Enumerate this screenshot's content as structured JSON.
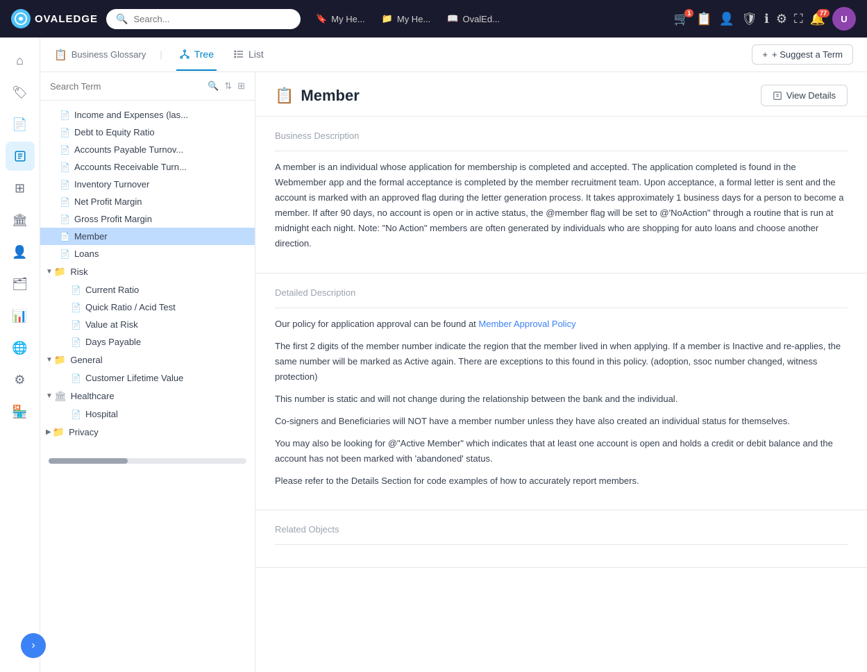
{
  "app": {
    "name": "OVALEDGE",
    "logo_char": "OE"
  },
  "topnav": {
    "search_placeholder": "Search...",
    "nav_items": [
      {
        "label": "My He...",
        "icon": "bookmark"
      },
      {
        "label": "My He...",
        "icon": "folder"
      },
      {
        "label": "OvalEd...",
        "icon": "book"
      }
    ],
    "icons": [
      {
        "name": "cart",
        "badge": "1"
      },
      {
        "name": "document"
      },
      {
        "name": "person-check"
      },
      {
        "name": "shield"
      },
      {
        "name": "info"
      },
      {
        "name": "settings"
      },
      {
        "name": "expand"
      },
      {
        "name": "bell",
        "badge": "77"
      }
    ]
  },
  "breadcrumb": {
    "label": "Business Glossary"
  },
  "tabs": [
    {
      "id": "tree",
      "label": "Tree",
      "active": true
    },
    {
      "id": "list",
      "label": "List",
      "active": false
    }
  ],
  "suggest_btn": "+ Suggest a Term",
  "search_placeholder": "Search Term",
  "tree_nodes": [
    {
      "id": "income",
      "label": "Income and Expenses (las...",
      "level": 1,
      "type": "doc",
      "expanded": false,
      "selected": false
    },
    {
      "id": "debt",
      "label": "Debt to Equity Ratio",
      "level": 1,
      "type": "doc",
      "expanded": false,
      "selected": false
    },
    {
      "id": "accounts_payable",
      "label": "Accounts Payable Turnov...",
      "level": 1,
      "type": "doc",
      "expanded": false,
      "selected": false
    },
    {
      "id": "accounts_receivable",
      "label": "Accounts Receivable Turn...",
      "level": 1,
      "type": "doc",
      "expanded": false,
      "selected": false
    },
    {
      "id": "inventory",
      "label": "Inventory Turnover",
      "level": 1,
      "type": "doc",
      "expanded": false,
      "selected": false
    },
    {
      "id": "net_profit",
      "label": "Net Profit Margin",
      "level": 1,
      "type": "doc",
      "expanded": false,
      "selected": false
    },
    {
      "id": "gross_profit",
      "label": "Gross Profit Margin",
      "level": 1,
      "type": "doc",
      "expanded": false,
      "selected": false
    },
    {
      "id": "member",
      "label": "Member",
      "level": 1,
      "type": "doc",
      "expanded": false,
      "selected": true
    },
    {
      "id": "loans",
      "label": "Loans",
      "level": 1,
      "type": "doc",
      "expanded": false,
      "selected": false
    },
    {
      "id": "risk",
      "label": "Risk",
      "level": 0,
      "type": "folder",
      "expanded": true,
      "selected": false
    },
    {
      "id": "current_ratio",
      "label": "Current Ratio",
      "level": 2,
      "type": "doc",
      "expanded": false,
      "selected": false
    },
    {
      "id": "quick_ratio",
      "label": "Quick Ratio / Acid Test",
      "level": 2,
      "type": "doc",
      "expanded": false,
      "selected": false
    },
    {
      "id": "value_at_risk",
      "label": "Value at Risk",
      "level": 2,
      "type": "doc",
      "expanded": false,
      "selected": false
    },
    {
      "id": "days_payable",
      "label": "Days Payable",
      "level": 2,
      "type": "doc",
      "expanded": false,
      "selected": false
    },
    {
      "id": "general",
      "label": "General",
      "level": 0,
      "type": "folder",
      "expanded": true,
      "selected": false
    },
    {
      "id": "customer_lifetime",
      "label": "Customer Lifetime Value",
      "level": 2,
      "type": "doc",
      "expanded": false,
      "selected": false
    },
    {
      "id": "healthcare",
      "label": "Healthcare",
      "level": 0,
      "type": "building",
      "expanded": true,
      "selected": false
    },
    {
      "id": "hospital",
      "label": "Hospital",
      "level": 2,
      "type": "doc",
      "expanded": false,
      "selected": false
    },
    {
      "id": "privacy",
      "label": "Privacy",
      "level": 0,
      "type": "folder",
      "expanded": false,
      "selected": false
    }
  ],
  "detail": {
    "title": "Member",
    "title_icon": "📋",
    "view_details_label": "View Details",
    "business_description_title": "Business Description",
    "business_description": "A member is an individual whose application for membership is completed and accepted. The application completed is found in the Webmember app and the formal acceptance is completed by the member recruitment team. Upon acceptance, a formal letter is sent and the account is marked with an approved flag during the letter generation process. It takes approximately 1 business days for a person to become a member. If after 90 days, no account is open or in active status, the @member flag will be set to @'NoAction\" through a routine that is run at midnight each night. Note: \"No Action\" members are often generated by individuals who are shopping for auto loans and choose another direction.",
    "detailed_description_title": "Detailed Description",
    "detailed_description_para1_prefix": "Our policy for application approval can be found at ",
    "detailed_description_link": "Member Approval Policy",
    "detailed_description_para2": "The first 2 digits of the member number indicate the region that the member lived in when applying. If a member is Inactive and re-applies, the same number will be marked as Active again. There are exceptions to this found in this policy. (adoption, ssoc number changed, witness protection)",
    "detailed_description_para3": "This number is static and will not change during the relationship between the bank and the individual.",
    "detailed_description_para4": "Co-signers and Beneficiaries will NOT have a member number unless they have also created an individual status for themselves.",
    "detailed_description_para5": "You may also be looking for @\"Active Member\" which indicates that at least one account is open and holds a credit or debit balance and the account has not been marked with 'abandoned' status.",
    "detailed_description_para6": "Please refer to the Details Section for code examples of how to accurately report members.",
    "related_objects_title": "Related Objects"
  },
  "sidebar_items": [
    {
      "id": "home",
      "icon": "⌂",
      "active": false
    },
    {
      "id": "tag",
      "icon": "🏷",
      "active": false
    },
    {
      "id": "document",
      "icon": "📄",
      "active": false
    },
    {
      "id": "glossary",
      "icon": "📘",
      "active": true
    },
    {
      "id": "grid",
      "icon": "⊞",
      "active": false
    },
    {
      "id": "building",
      "icon": "🏛",
      "active": false
    },
    {
      "id": "person",
      "icon": "👤",
      "active": false
    },
    {
      "id": "folder2",
      "icon": "🗂",
      "active": false
    },
    {
      "id": "chart",
      "icon": "📊",
      "active": false
    },
    {
      "id": "globe",
      "icon": "🌐",
      "active": false
    },
    {
      "id": "sliders",
      "icon": "⚙",
      "active": false
    },
    {
      "id": "store",
      "icon": "🏪",
      "active": false
    }
  ]
}
